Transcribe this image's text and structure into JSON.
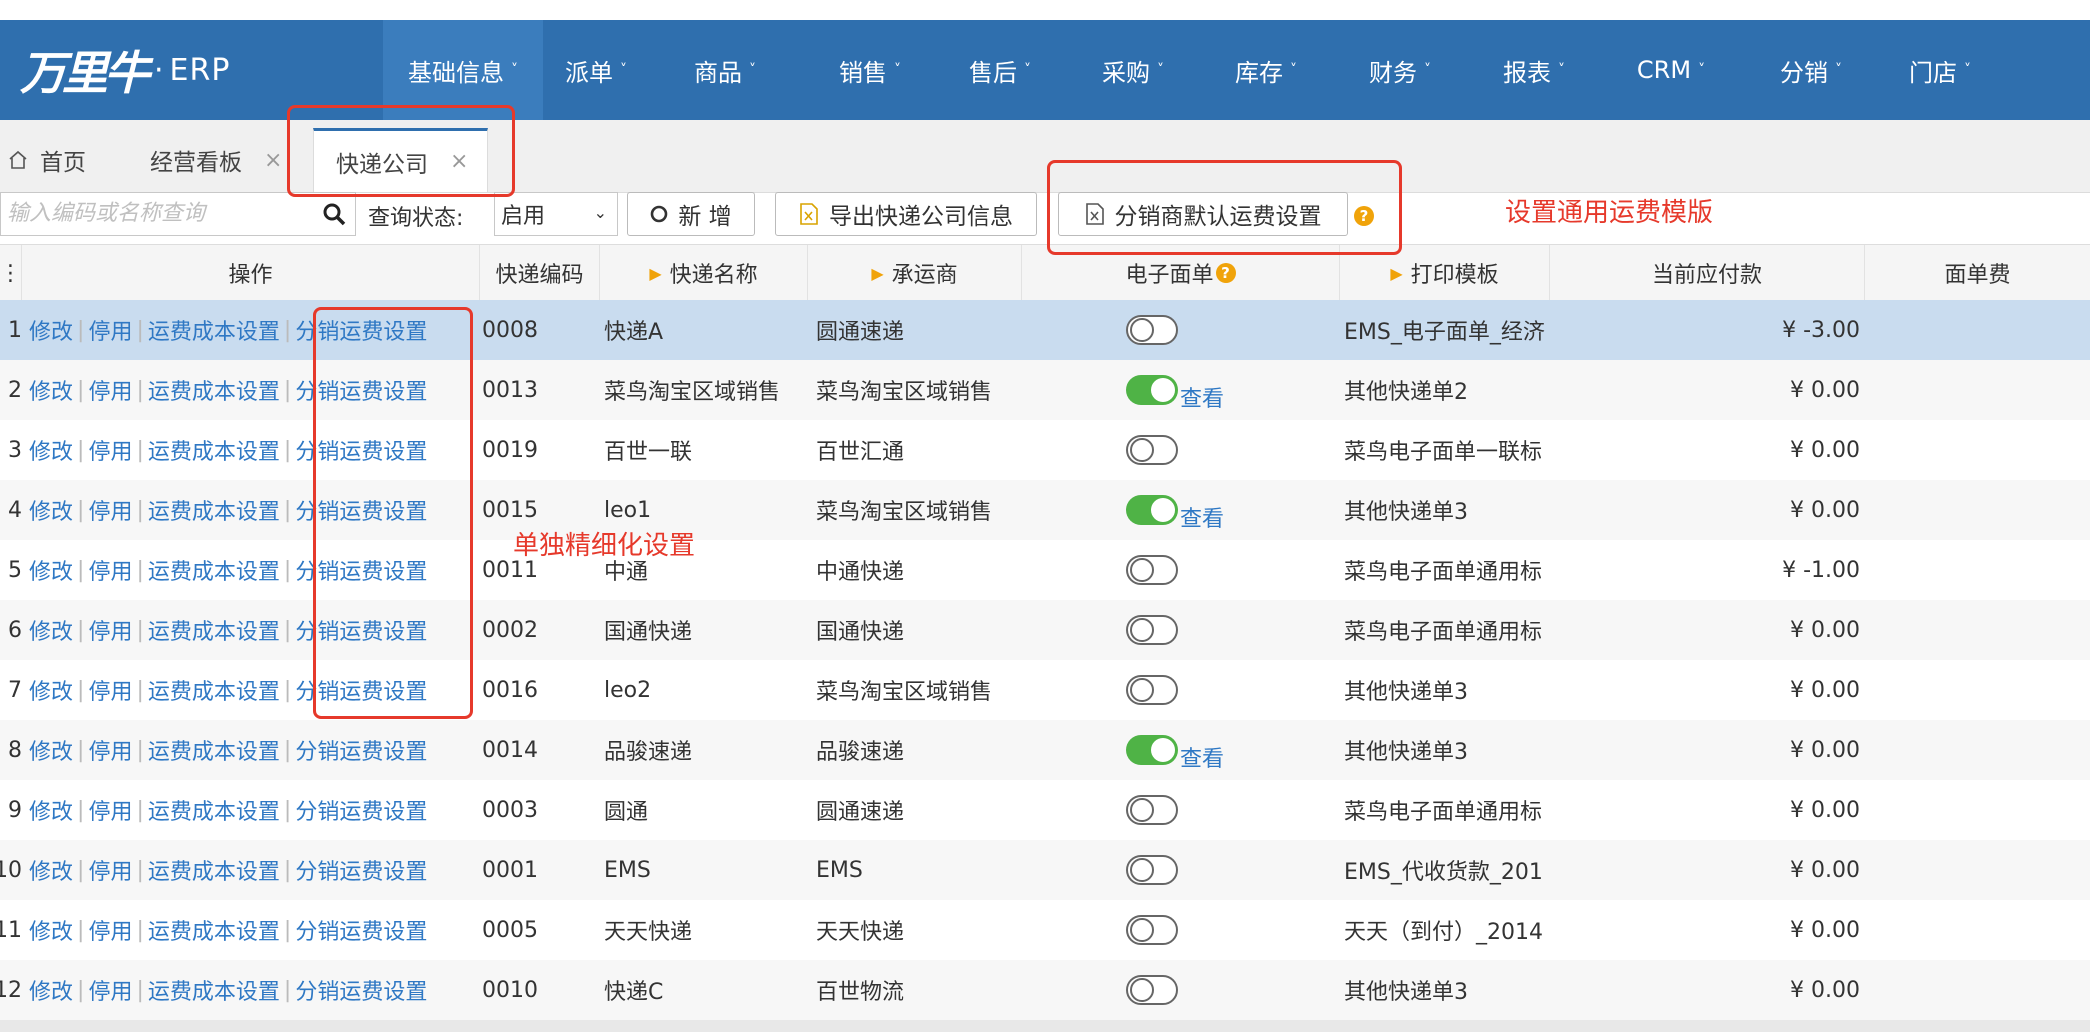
{
  "brand": {
    "logo": "万里牛",
    "dot": "·",
    "name": "ERP"
  },
  "nav": [
    {
      "label": "基础信息",
      "active": true
    },
    {
      "label": "派单"
    },
    {
      "label": "商品"
    },
    {
      "label": "销售"
    },
    {
      "label": "售后"
    },
    {
      "label": "采购"
    },
    {
      "label": "库存"
    },
    {
      "label": "财务"
    },
    {
      "label": "报表"
    },
    {
      "label": "CRM"
    },
    {
      "label": "分销"
    },
    {
      "label": "门店"
    }
  ],
  "tabs": {
    "home": "首页",
    "dashboard": "经营看板",
    "express": "快递公司",
    "close": "×"
  },
  "toolbar": {
    "search_placeholder": "输入编码或名称查询",
    "status_label": "查询状态:",
    "status_value": "启用",
    "add_label": "新 增",
    "export_label": "导出快递公司信息",
    "default_freight_label": "分销商默认运费设置"
  },
  "annotations": {
    "general": "设置通用运费模版",
    "individual": "单独精细化设置"
  },
  "columns": {
    "ops": "操作",
    "code": "快递编码",
    "name": "快递名称",
    "carrier": "承运商",
    "eorder": "电子面单",
    "template": "打印模板",
    "payable": "当前应付款",
    "fee": "面单费"
  },
  "actions": {
    "edit": "修改",
    "disable": "停用",
    "cost": "运费成本设置",
    "dist": "分销运费设置"
  },
  "view_label": "查看",
  "rows": [
    {
      "no": "1",
      "code": "0008",
      "name": "快递A",
      "carrier": "圆通速递",
      "eorder": false,
      "template": "EMS_电子面单_经济",
      "payable": "¥ -3.00"
    },
    {
      "no": "2",
      "code": "0013",
      "name": "菜鸟淘宝区域销售",
      "carrier": "菜鸟淘宝区域销售",
      "eorder": true,
      "template": "其他快递单2",
      "payable": "¥ 0.00"
    },
    {
      "no": "3",
      "code": "0019",
      "name": "百世一联",
      "carrier": "百世汇通",
      "eorder": false,
      "template": "菜鸟电子面单一联标",
      "payable": "¥ 0.00"
    },
    {
      "no": "4",
      "code": "0015",
      "name": "leo1",
      "carrier": "菜鸟淘宝区域销售",
      "eorder": true,
      "template": "其他快递单3",
      "payable": "¥ 0.00"
    },
    {
      "no": "5",
      "code": "0011",
      "name": "中通",
      "carrier": "中通快递",
      "eorder": false,
      "template": "菜鸟电子面单通用标",
      "payable": "¥ -1.00"
    },
    {
      "no": "6",
      "code": "0002",
      "name": "国通快递",
      "carrier": "国通快递",
      "eorder": false,
      "template": "菜鸟电子面单通用标",
      "payable": "¥ 0.00"
    },
    {
      "no": "7",
      "code": "0016",
      "name": "leo2",
      "carrier": "菜鸟淘宝区域销售",
      "eorder": false,
      "template": "其他快递单3",
      "payable": "¥ 0.00"
    },
    {
      "no": "8",
      "code": "0014",
      "name": "品骏速递",
      "carrier": "品骏速递",
      "eorder": true,
      "template": "其他快递单3",
      "payable": "¥ 0.00"
    },
    {
      "no": "9",
      "code": "0003",
      "name": "圆通",
      "carrier": "圆通速递",
      "eorder": false,
      "template": "菜鸟电子面单通用标",
      "payable": "¥ 0.00"
    },
    {
      "no": "10",
      "code": "0001",
      "name": "EMS",
      "carrier": "EMS",
      "eorder": false,
      "template": "EMS_代收货款_201",
      "payable": "¥ 0.00"
    },
    {
      "no": "11",
      "code": "0005",
      "name": "天天快递",
      "carrier": "天天快递",
      "eorder": false,
      "template": "天天（到付）_2014",
      "payable": "¥ 0.00"
    },
    {
      "no": "12",
      "code": "0010",
      "name": "快递C",
      "carrier": "百世物流",
      "eorder": false,
      "template": "其他快递单3",
      "payable": "¥ 0.00"
    }
  ],
  "colors": {
    "nav": "#2f6fae",
    "link": "#2f78c4",
    "annotation": "#e6392b",
    "toggle_on": "#4fb346",
    "selected_row": "#c9dcef"
  }
}
